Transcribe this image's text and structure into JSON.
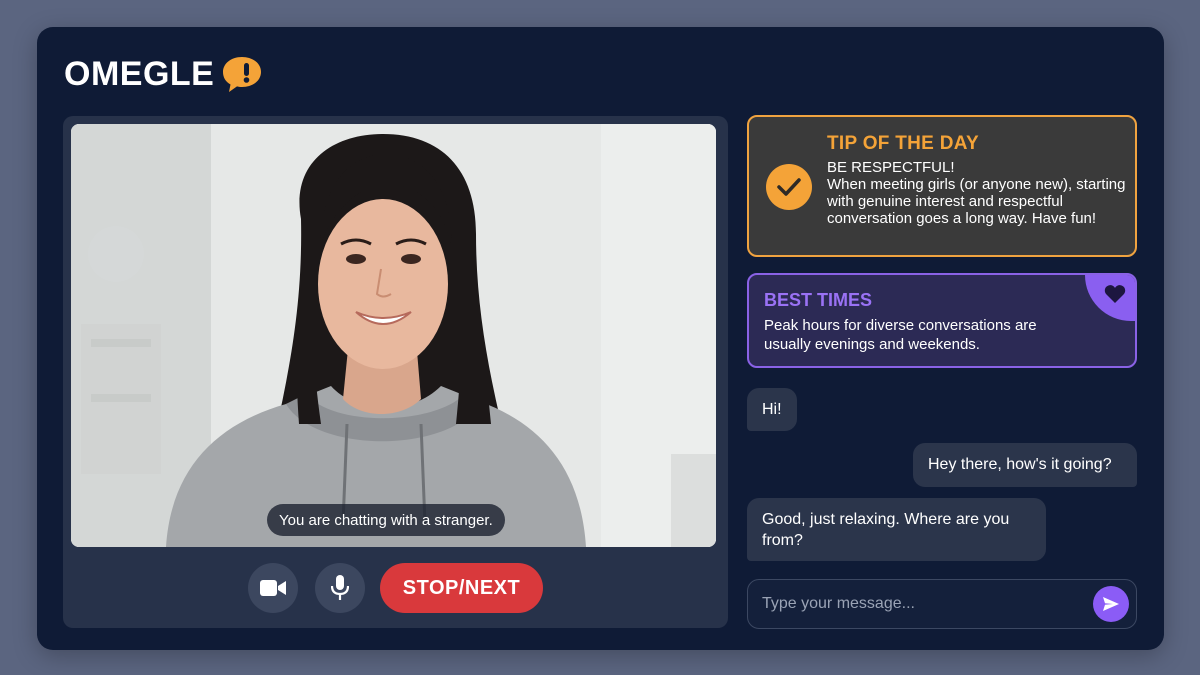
{
  "app": {
    "logo_text": "OMEGLE",
    "logo_icon": "exclamation-chat-bubble-icon",
    "brand_color": "#f4a338"
  },
  "video": {
    "caption": "You are chatting with a stranger.",
    "controls": {
      "camera_icon": "video-camera-icon",
      "mic_icon": "microphone-icon",
      "stop_next_label": "STOP/NEXT",
      "stop_color": "#d9393c"
    }
  },
  "tip": {
    "title": "TIP OF THE DAY",
    "heading": "BE RESPECTFUL!",
    "body": "When meeting girls (or anyone new), starting with genuine interest and respectful conversation goes a long way. Have fun!",
    "icon": "check-circle-icon",
    "accent": "#f0a340"
  },
  "best_times": {
    "title": "BEST TIMES",
    "body": "Peak hours for diverse conversations are usually evenings and weekends.",
    "icon": "heart-icon",
    "accent": "#8a62e6"
  },
  "chat": {
    "messages": [
      {
        "from": "stranger",
        "text": "Hi!"
      },
      {
        "from": "you",
        "text": "Hey there, how's it going?"
      },
      {
        "from": "stranger",
        "text": "Good, just relaxing. Where are you from?"
      }
    ],
    "input_placeholder": "Type your message...",
    "send_icon": "send-icon",
    "send_color": "#8b5cf6"
  }
}
